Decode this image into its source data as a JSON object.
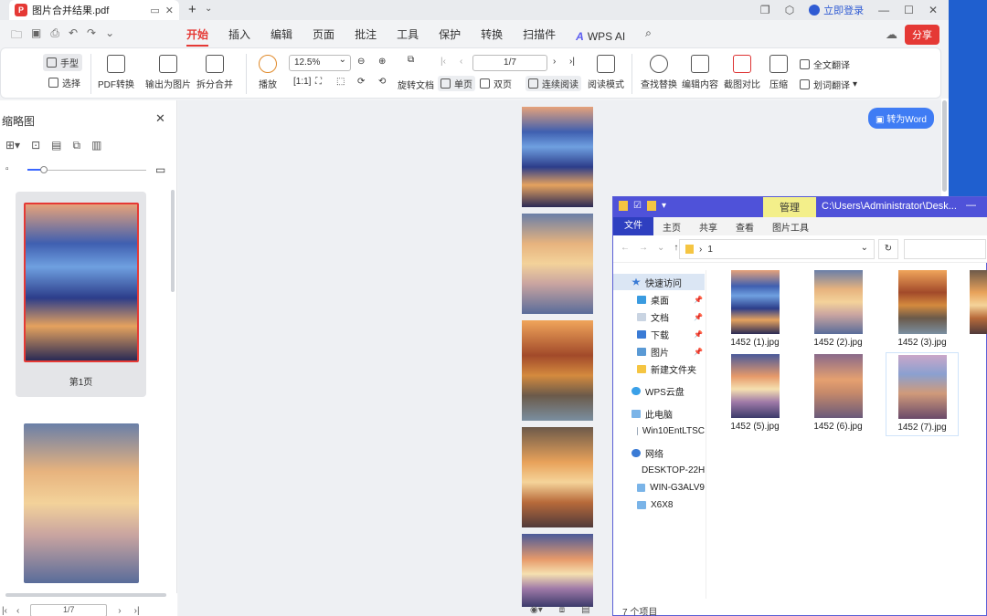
{
  "titlebar": {
    "doc_title": "图片合并结果.pdf",
    "login": "立即登录"
  },
  "menubar": {
    "items": [
      "开始",
      "插入",
      "批注",
      "页面",
      "批注",
      "工具",
      "保护",
      "转换",
      "扫描件"
    ],
    "real_items": [
      "开始",
      "插入",
      "编辑",
      "页面",
      "批注",
      "工具",
      "保护",
      "转换",
      "扫描件"
    ],
    "wps_ai": "WPS AI",
    "share": "分享"
  },
  "ribbon": {
    "hand": "手型",
    "select": "选择",
    "pdf_convert": "PDF转换",
    "export_image": "输出为图片",
    "split_merge": "拆分合并",
    "play": "播放",
    "zoom": "12.5%",
    "page": "1/7",
    "rotate_doc": "旋转文档",
    "single_page": "单页",
    "double_page": "双页",
    "continuous": "连续阅读",
    "read_mode": "阅读模式",
    "find_replace": "查找替换",
    "edit_content": "编辑内容",
    "screenshot_compare": "截图对比",
    "compress": "压缩",
    "full_translate": "全文翻译",
    "word_translate": "划词翻译"
  },
  "sidebar": {
    "title": "缩略图",
    "page1_label": "第1页",
    "pager": "1/7"
  },
  "main": {
    "convert_word": "转为Word"
  },
  "explorer": {
    "manage": "管理",
    "path_title": "C:\\Users\\Administrator\\Desk...",
    "tabs": [
      "文件",
      "主页",
      "共享",
      "查看",
      "图片工具"
    ],
    "address": "1",
    "nav": [
      "快速访问",
      "桌面",
      "文档",
      "下载",
      "图片",
      "新建文件夹",
      "WPS云盘",
      "此电脑",
      "Win10EntLTSC",
      "网络",
      "DESKTOP-22H",
      "WIN-G3ALV9",
      "X6X8"
    ],
    "files": [
      "1452 (1).jpg",
      "1452 (2).jpg",
      "1452 (3).jpg",
      "1452 (5).jpg",
      "1452 (6).jpg",
      "1452 (7).jpg"
    ],
    "status": "7 个项目"
  }
}
